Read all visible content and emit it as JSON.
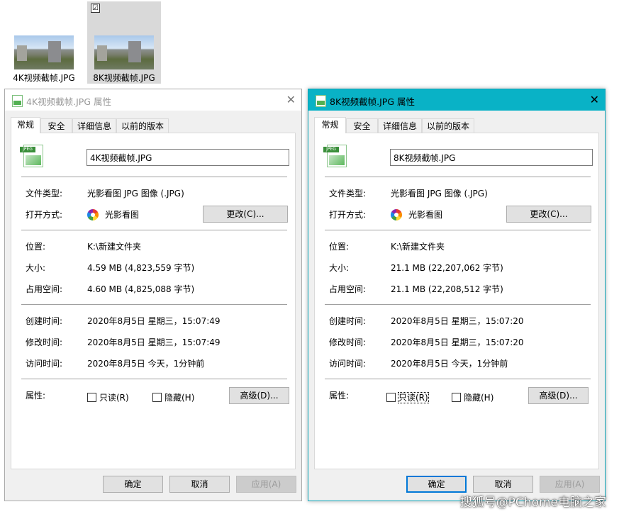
{
  "thumbnails": [
    {
      "caption": "4K视频截帧.JPG",
      "selected": false
    },
    {
      "caption": "8K视频截帧.JPG",
      "selected": true,
      "checkbox": "☑"
    }
  ],
  "dialogs": [
    {
      "title": "4K视频截帧.JPG 属性",
      "active": false,
      "tabs": [
        "常规",
        "安全",
        "详细信息",
        "以前的版本"
      ],
      "filename": "4K视频截帧.JPG",
      "file_type_label": "文件类型:",
      "file_type": "光影看图 JPG 图像 (.JPG)",
      "open_with_label": "打开方式:",
      "open_with": "光影看图",
      "change_button": "更改(C)...",
      "location_label": "位置:",
      "location": "K:\\新建文件夹",
      "size_label": "大小:",
      "size": "4.59 MB (4,823,559 字节)",
      "disk_size_label": "占用空间:",
      "disk_size": "4.60 MB (4,825,088 字节)",
      "created_label": "创建时间:",
      "created": "2020年8月5日 星期三，15:07:49",
      "modified_label": "修改时间:",
      "modified": "2020年8月5日 星期三，15:07:49",
      "accessed_label": "访问时间:",
      "accessed": "2020年8月5日 今天，1分钟前",
      "attributes_label": "属性:",
      "readonly_label": "只读(R)",
      "hidden_label": "隐藏(H)",
      "advanced_button": "高级(D)...",
      "ok_button": "确定",
      "cancel_button": "取消",
      "apply_button": "应用(A)"
    },
    {
      "title": "8K视频截帧.JPG 属性",
      "active": true,
      "tabs": [
        "常规",
        "安全",
        "详细信息",
        "以前的版本"
      ],
      "filename": "8K视频截帧.JPG",
      "file_type_label": "文件类型:",
      "file_type": "光影看图 JPG 图像 (.JPG)",
      "open_with_label": "打开方式:",
      "open_with": "光影看图",
      "change_button": "更改(C)...",
      "location_label": "位置:",
      "location": "K:\\新建文件夹",
      "size_label": "大小:",
      "size": "21.1 MB (22,207,062 字节)",
      "disk_size_label": "占用空间:",
      "disk_size": "21.1 MB (22,208,512 字节)",
      "created_label": "创建时间:",
      "created": "2020年8月5日 星期三，15:07:20",
      "modified_label": "修改时间:",
      "modified": "2020年8月5日 星期三，15:07:20",
      "accessed_label": "访问时间:",
      "accessed": "2020年8月5日 今天，1分钟前",
      "attributes_label": "属性:",
      "readonly_label": "只读(R)",
      "hidden_label": "隐藏(H)",
      "advanced_button": "高级(D)...",
      "ok_button": "确定",
      "cancel_button": "取消",
      "apply_button": "应用(A)"
    }
  ],
  "icons": {
    "file_badge": "JPEG",
    "close_glyph": "✕"
  },
  "watermark": "搜狐号@PChome电脑之家",
  "colors": {
    "active_titlebar": "#09b2c6",
    "selection_highlight": "#d9d9d9",
    "primary_border": "#0078d7"
  }
}
